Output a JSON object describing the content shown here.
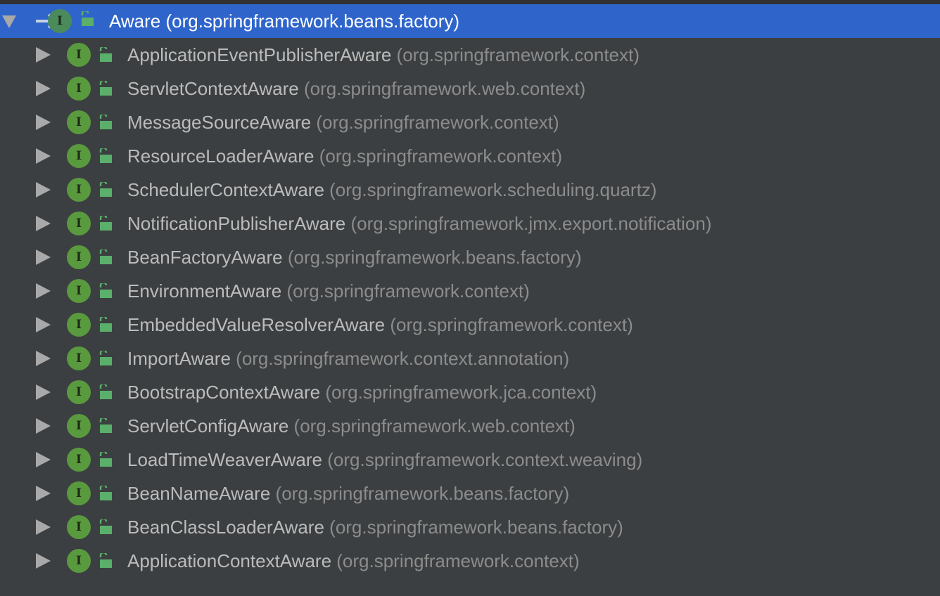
{
  "root": {
    "name": "Aware",
    "package": "(org.springframework.beans.factory)"
  },
  "children": [
    {
      "name": "ApplicationEventPublisherAware",
      "package": "(org.springframework.context)"
    },
    {
      "name": "ServletContextAware",
      "package": "(org.springframework.web.context)"
    },
    {
      "name": "MessageSourceAware",
      "package": "(org.springframework.context)"
    },
    {
      "name": "ResourceLoaderAware",
      "package": "(org.springframework.context)"
    },
    {
      "name": "SchedulerContextAware",
      "package": "(org.springframework.scheduling.quartz)"
    },
    {
      "name": "NotificationPublisherAware",
      "package": "(org.springframework.jmx.export.notification)"
    },
    {
      "name": "BeanFactoryAware",
      "package": "(org.springframework.beans.factory)"
    },
    {
      "name": "EnvironmentAware",
      "package": "(org.springframework.context)"
    },
    {
      "name": "EmbeddedValueResolverAware",
      "package": "(org.springframework.context)"
    },
    {
      "name": "ImportAware",
      "package": "(org.springframework.context.annotation)"
    },
    {
      "name": "BootstrapContextAware",
      "package": "(org.springframework.jca.context)"
    },
    {
      "name": "ServletConfigAware",
      "package": "(org.springframework.web.context)"
    },
    {
      "name": "LoadTimeWeaverAware",
      "package": "(org.springframework.context.weaving)"
    },
    {
      "name": "BeanNameAware",
      "package": "(org.springframework.beans.factory)"
    },
    {
      "name": "BeanClassLoaderAware",
      "package": "(org.springframework.beans.factory)"
    },
    {
      "name": "ApplicationContextAware",
      "package": "(org.springframework.context)"
    }
  ],
  "icons": {
    "interface_glyph": "I",
    "interface_color": "#5a9a3f",
    "selection_color": "#2f65ca"
  }
}
